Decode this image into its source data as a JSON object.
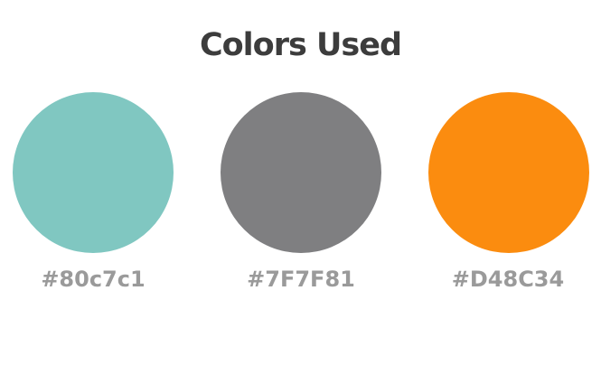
{
  "title": "Colors Used",
  "swatches": [
    {
      "label": "#80c7c1",
      "color": "#80c7c1"
    },
    {
      "label": "#7F7F81",
      "color": "#7f7f81"
    },
    {
      "label": "#D48C34",
      "color": "#fb8c0f"
    }
  ]
}
